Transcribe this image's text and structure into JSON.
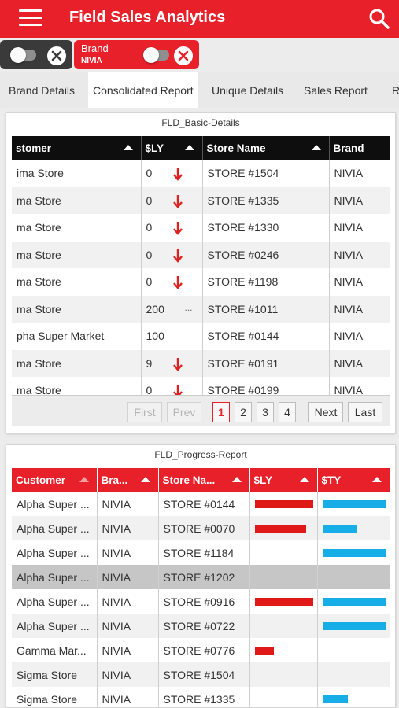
{
  "app": {
    "title": "Field Sales Analytics",
    "colors": {
      "primary": "#e8202a",
      "dark": "#0e0e0e",
      "bar_ly": "#e01818",
      "bar_ty": "#17aee8"
    }
  },
  "filters": {
    "brand_chip": {
      "label": "Brand",
      "value": "NIVIA"
    }
  },
  "tabs": [
    {
      "label": "Brand Details"
    },
    {
      "label": "Consolidated Report"
    },
    {
      "label": "Unique Details"
    },
    {
      "label": "Sales Report"
    },
    {
      "label": "R"
    }
  ],
  "basic_details": {
    "title": "FLD_Basic-Details",
    "columns": [
      "stomer",
      "$LY",
      "Store Name",
      "Brand"
    ],
    "rows": [
      {
        "customer": "ima Store",
        "ly": "0",
        "trend": "down",
        "store": "STORE #1504",
        "brand": "NIVIA"
      },
      {
        "customer": "ma Store",
        "ly": "0",
        "trend": "down",
        "store": "STORE #1335",
        "brand": "NIVIA"
      },
      {
        "customer": "ma Store",
        "ly": "0",
        "trend": "down",
        "store": "STORE #1330",
        "brand": "NIVIA"
      },
      {
        "customer": "ma Store",
        "ly": "0",
        "trend": "down",
        "store": "STORE #0246",
        "brand": "NIVIA"
      },
      {
        "customer": "ma Store",
        "ly": "0",
        "trend": "down",
        "store": "STORE #1198",
        "brand": "NIVIA"
      },
      {
        "customer": "ma Store",
        "ly": "200",
        "trend": "ellipsis",
        "store": "STORE #1011",
        "brand": "NIVIA"
      },
      {
        "customer": "pha Super Market",
        "ly": "100",
        "trend": "none",
        "store": "STORE #0144",
        "brand": "NIVIA"
      },
      {
        "customer": "ma Store",
        "ly": "9",
        "trend": "down",
        "store": "STORE #0191",
        "brand": "NIVIA"
      },
      {
        "customer": "ma Store",
        "ly": "0",
        "trend": "down",
        "store": "STORE #0199",
        "brand": "NIVIA"
      }
    ],
    "pager": {
      "first": "First",
      "prev": "Prev",
      "pages": [
        "1",
        "2",
        "3",
        "4"
      ],
      "next": "Next",
      "last": "Last"
    }
  },
  "progress_report": {
    "title": "FLD_Progress-Report",
    "columns": [
      "Customer",
      "Bra...",
      "Store Na...",
      "$LY",
      "$TY"
    ],
    "rows": [
      {
        "customer": "Alpha Super ...",
        "brand": "NIVIA",
        "store": "STORE #0144",
        "ly": 1.0,
        "ty": 1.0
      },
      {
        "customer": "Alpha Super ...",
        "brand": "NIVIA",
        "store": "STORE #0070",
        "ly": 0.88,
        "ty": 0.55
      },
      {
        "customer": "Alpha Super ...",
        "brand": "NIVIA",
        "store": "STORE #1184",
        "ly": 0,
        "ty": 1.0
      },
      {
        "customer": "Alpha Super ...",
        "brand": "NIVIA",
        "store": "STORE #1202",
        "ly": 0,
        "ty": 0,
        "selected": true
      },
      {
        "customer": "Alpha Super ...",
        "brand": "NIVIA",
        "store": "STORE #0916",
        "ly": 1.0,
        "ty": 1.0
      },
      {
        "customer": "Alpha Super ...",
        "brand": "NIVIA",
        "store": "STORE #0722",
        "ly": 0,
        "ty": 1.0
      },
      {
        "customer": "Gamma Mar...",
        "brand": "NIVIA",
        "store": "STORE #0776",
        "ly": 0.33,
        "ty": 0
      },
      {
        "customer": "Sigma Store",
        "brand": "NIVIA",
        "store": "STORE #1504",
        "ly": 0,
        "ty": 0
      },
      {
        "customer": "Sigma Store",
        "brand": "NIVIA",
        "store": "STORE #1335",
        "ly": 0,
        "ty": 0.4
      }
    ]
  }
}
